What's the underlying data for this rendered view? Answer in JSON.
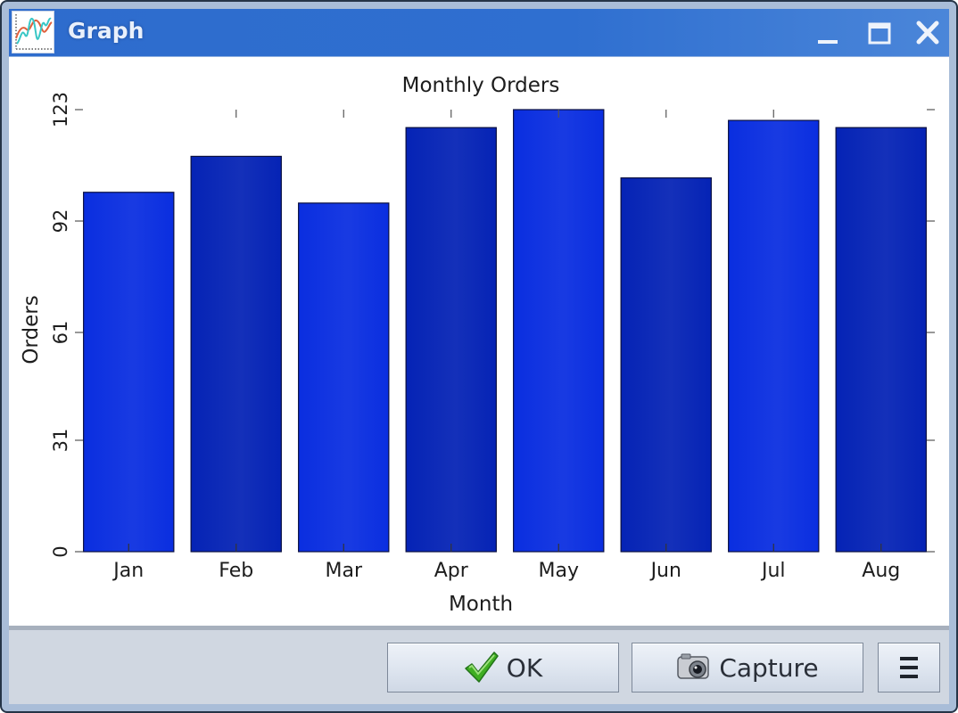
{
  "window": {
    "title": "Graph",
    "app_icon": "line-graph-icon",
    "controls": {
      "minimize": "minimize-icon",
      "maximize": "maximize-icon",
      "close": "close-icon"
    }
  },
  "colors": {
    "titlebar": "#2f6fd0",
    "bar_light": "#0a2ee0",
    "bar_dark": "#0523b5",
    "bottombar": "#d0d7e1"
  },
  "buttons": {
    "ok": {
      "label": "OK",
      "icon": "checkmark-icon"
    },
    "capture": {
      "label": "Capture",
      "icon": "camera-icon"
    },
    "menu": {
      "label": "",
      "icon": "hamburger-menu-icon"
    }
  },
  "chart_data": {
    "type": "bar",
    "title": "Monthly Orders",
    "xlabel": "Month",
    "ylabel": "Orders",
    "categories": [
      "Jan",
      "Feb",
      "Mar",
      "Apr",
      "May",
      "Jun",
      "Jul",
      "Aug"
    ],
    "values": [
      100,
      110,
      97,
      118,
      123,
      104,
      120,
      118
    ],
    "ylim": [
      0,
      123
    ],
    "yticks": [
      0,
      31,
      61,
      92,
      123
    ],
    "yticklabels": [
      "0",
      "31",
      "61",
      "92",
      "123"
    ],
    "grid": false,
    "legend": "none"
  }
}
